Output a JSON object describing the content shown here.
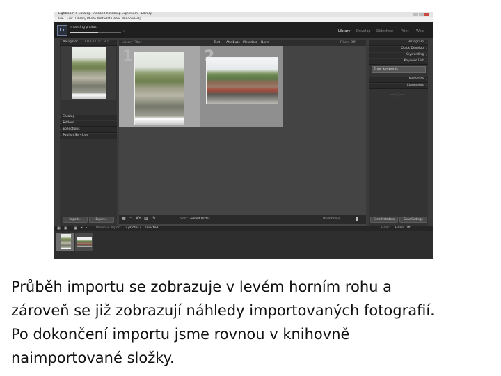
{
  "window": {
    "title": "Lightroom 4 Catalog - Adobe Photoshop Lightroom - Library"
  },
  "menu": [
    "File",
    "Edit",
    "Library",
    "Photo",
    "Metadata",
    "View",
    "Window",
    "Help"
  ],
  "identity": {
    "status": "Importing photos",
    "progress": 0.55
  },
  "modules": [
    "Library",
    "Develop",
    "Slideshow",
    "Print",
    "Web"
  ],
  "active_module": "Library",
  "left_panel": {
    "header": "Navigator",
    "header_options": "FIT   FILL   1:1   3:1",
    "sections": [
      "Catalog",
      "Folders",
      "Collections",
      "Publish Services"
    ]
  },
  "center": {
    "header_text": "Library Filter",
    "filter_tabs": [
      "Text",
      "Attribute",
      "Metadata",
      "None"
    ],
    "filter_status": "Filters Off",
    "cell_numbers": [
      "1",
      "2"
    ]
  },
  "right_panel": {
    "histogram": "Histogram",
    "preset_label": "Preset",
    "preset_value": "Quick Develop",
    "keywording": "Keywording",
    "keyword_list": "Keyword List",
    "keyword_field": "Enter keywords",
    "metadata_label": "Default",
    "metadata": "Metadata",
    "comments": "Comments"
  },
  "toolbar": {
    "import": "Import...",
    "export": "Export...",
    "sort_label": "Sort:",
    "sort_value": "Added Order",
    "thumbnails": "Thumbnails",
    "sync_metadata": "Sync Metadata",
    "sync_settings": "Sync Settings"
  },
  "filmstrip": {
    "source": "Previous Import",
    "count": "2 photos / 1 selected",
    "filter_label": "Filter:",
    "filter_value": "Filters Off"
  },
  "caption": [
    "Průběh importu se zobrazuje v levém horním rohu a",
    "zároveň se již zobrazují náhledy importovaných fotografií.",
    "Po dokončení importu jsme rovnou v knihovně",
    "naimportované složky."
  ]
}
